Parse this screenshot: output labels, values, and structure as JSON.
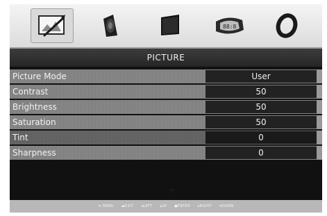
{
  "menu": {
    "title": "PICTURE",
    "tabs": [
      {
        "icon": "picture-settings-icon",
        "selected": true
      },
      {
        "icon": "speaker-icon",
        "selected": false
      },
      {
        "icon": "tv-screen-icon",
        "selected": false
      },
      {
        "icon": "clock-icon",
        "selected": false
      },
      {
        "icon": "option-ring-icon",
        "selected": false
      }
    ],
    "items": [
      {
        "label": "Picture Mode",
        "value": "User"
      },
      {
        "label": "Contrast",
        "value": "50"
      },
      {
        "label": "Brightness",
        "value": "50"
      },
      {
        "label": "Saturation",
        "value": "50"
      },
      {
        "label": "Tint",
        "value": "0",
        "selected": true
      },
      {
        "label": "Sharpness",
        "value": "0"
      }
    ]
  },
  "footer": {
    "hints": [
      "≡ MENU",
      "⏏EXIT",
      "◂LEFT",
      "▴UP",
      "●ENTER",
      "▸RIGHT",
      "▾DOWN"
    ]
  }
}
